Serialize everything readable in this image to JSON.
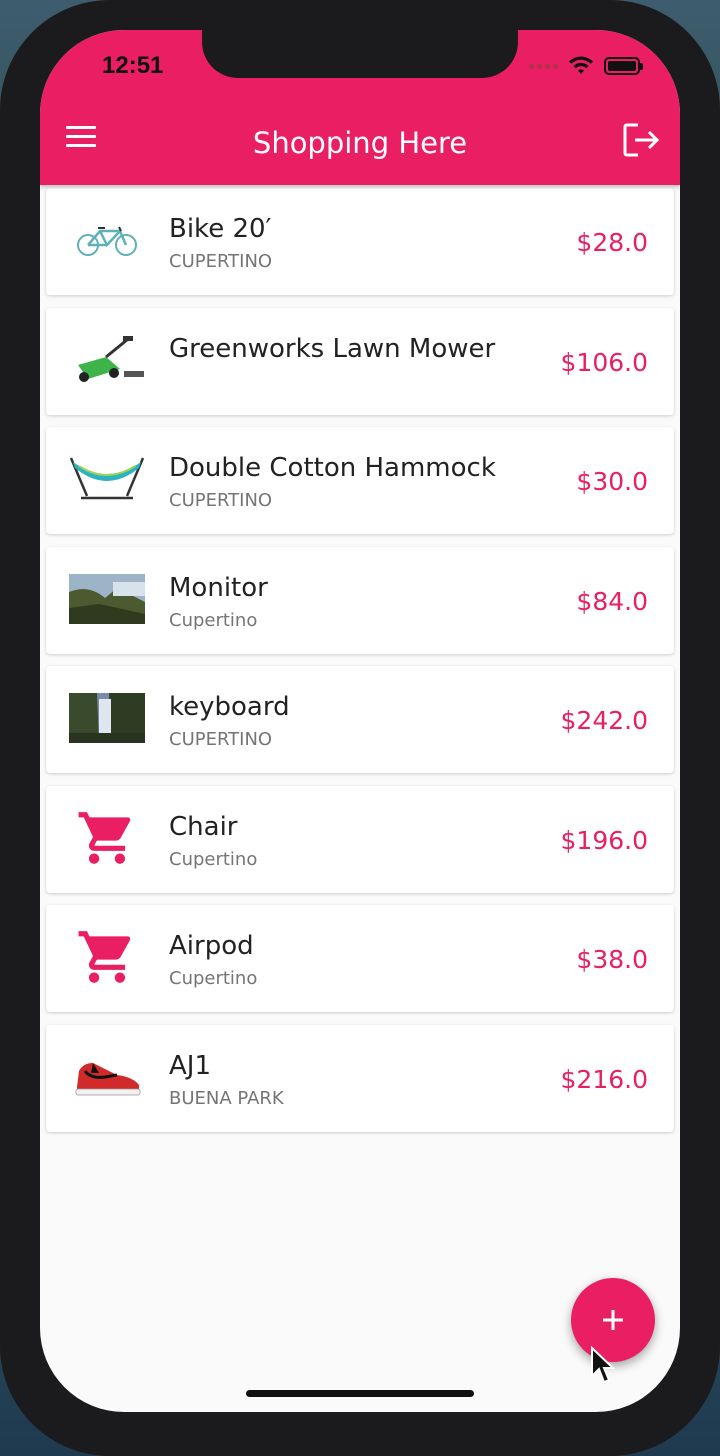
{
  "status_bar": {
    "time": "12:51"
  },
  "app_bar": {
    "title": "Shopping Here",
    "menu_icon": "menu-icon",
    "logout_icon": "logout-icon"
  },
  "items": [
    {
      "title": "Bike 20′",
      "location": "CUPERTINO",
      "price": "$28.0",
      "thumbnail": "bike-image"
    },
    {
      "title": "Greenworks  Lawn Mower",
      "location": "",
      "price": "$106.0",
      "thumbnail": "lawn-mower-image"
    },
    {
      "title": "Double Cotton Hammock",
      "location": "CUPERTINO",
      "price": "$30.0",
      "thumbnail": "hammock-image"
    },
    {
      "title": "Monitor",
      "location": "Cupertino",
      "price": "$84.0",
      "thumbnail": "landscape-photo"
    },
    {
      "title": "keyboard",
      "location": "CUPERTINO",
      "price": "$242.0",
      "thumbnail": "waterfall-photo"
    },
    {
      "title": "Chair",
      "location": "Cupertino",
      "price": "$196.0",
      "thumbnail": "cart-icon"
    },
    {
      "title": "Airpod",
      "location": "Cupertino",
      "price": "$38.0",
      "thumbnail": "cart-icon"
    },
    {
      "title": "AJ1",
      "location": "BUENA PARK",
      "price": "$216.0",
      "thumbnail": "sneaker-image"
    }
  ],
  "fab": {
    "icon": "plus-icon"
  },
  "colors": {
    "accent": "#e91e63",
    "price": "#e91e63",
    "background": "#fafafa"
  }
}
